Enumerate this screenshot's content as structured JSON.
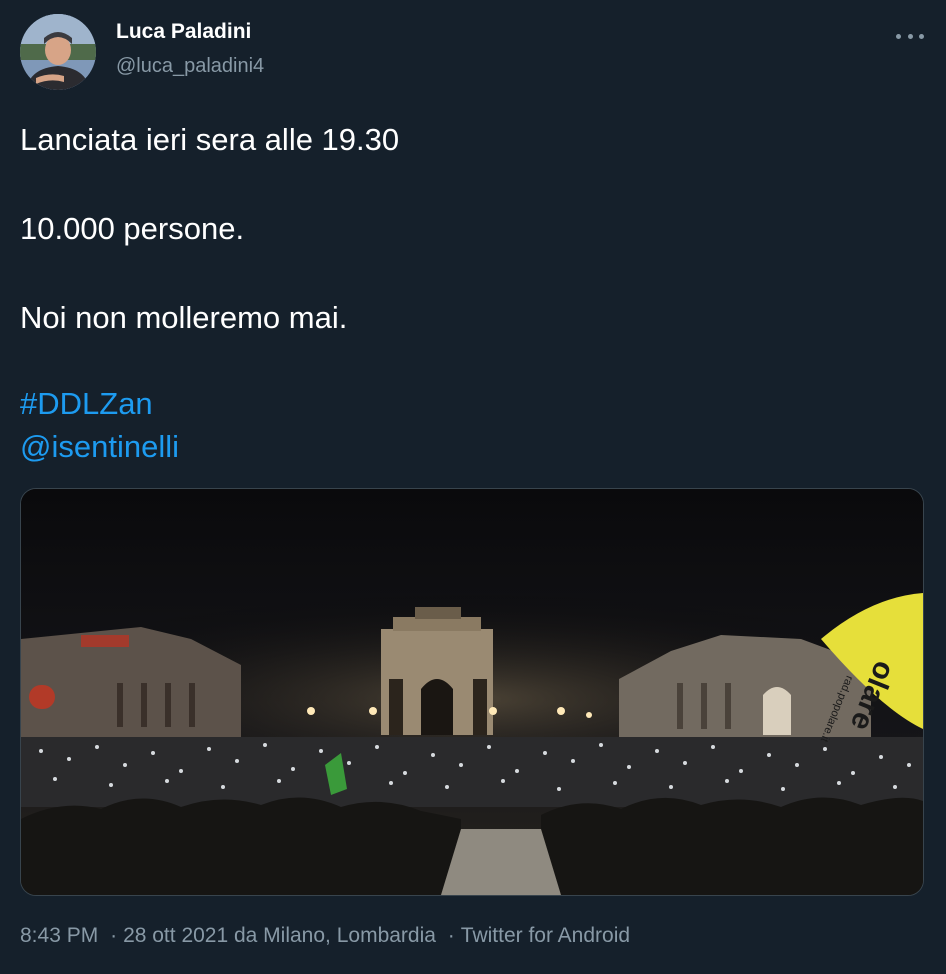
{
  "author": {
    "name": "Luca Paladini",
    "handle": "@luca_paladini4"
  },
  "tweet": {
    "line1": "Lanciata ieri sera alle 19.30",
    "line2": "10.000 persone.",
    "line3": "Noi non molleremo mai.",
    "hashtag": "#DDLZan",
    "mention": "@isentinelli"
  },
  "media": {
    "banner_text": "olare",
    "banner_subtext": "rad.popolare.it"
  },
  "meta": {
    "time": "8:43 PM",
    "separator": "·",
    "date_location": "28 ott 2021 da Milano, Lombardia",
    "source": "Twitter for Android"
  },
  "colors": {
    "background": "#15202b",
    "link": "#1d9bf0",
    "secondary_text": "#8899a6",
    "border": "#38444d"
  },
  "icons": {
    "more": "more-options-icon"
  }
}
